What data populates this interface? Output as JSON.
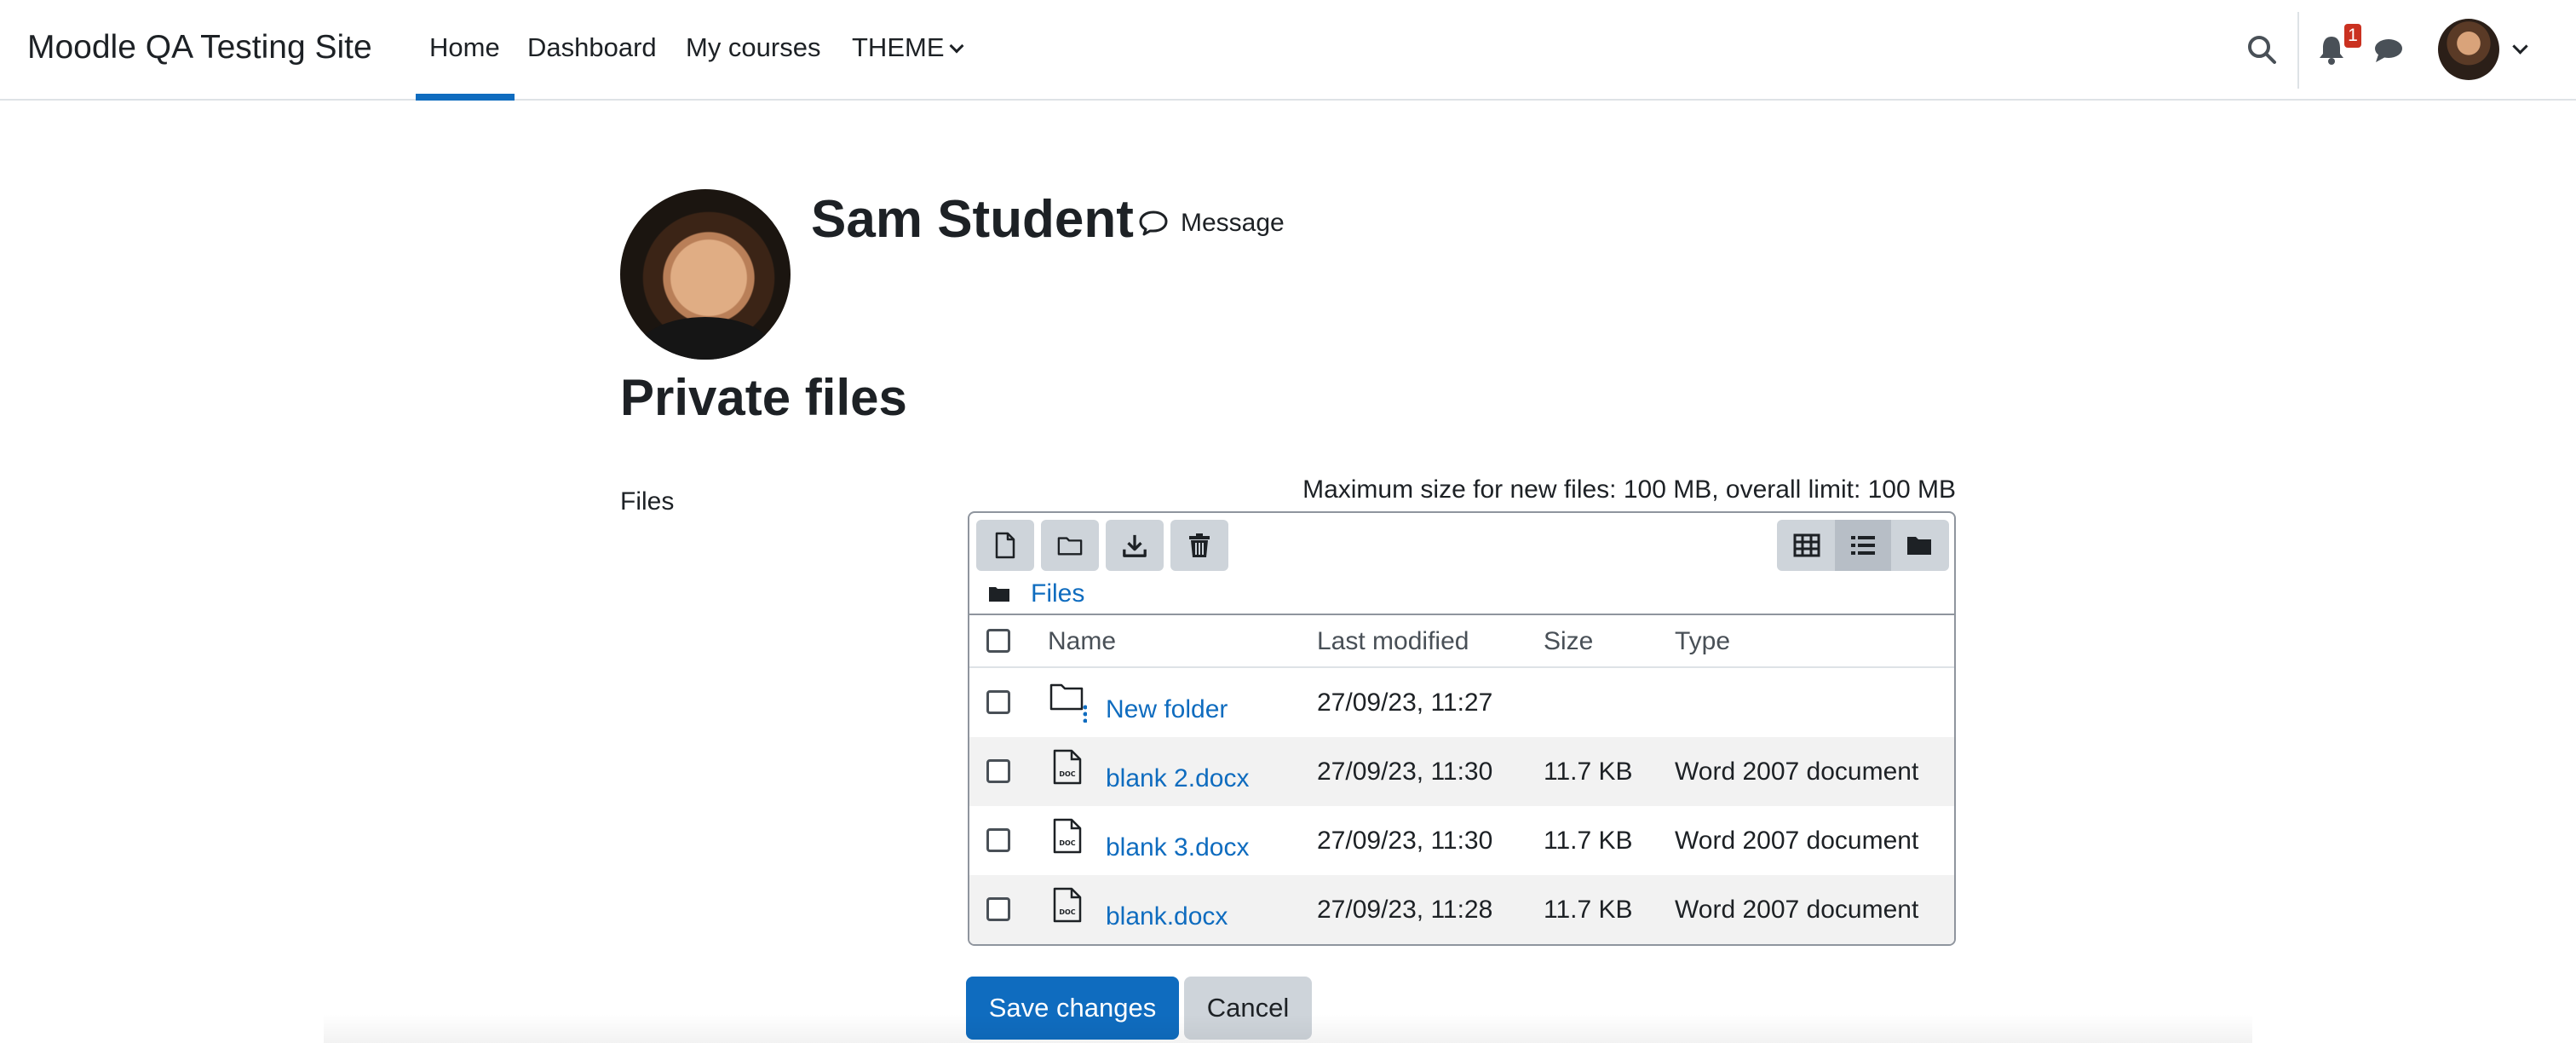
{
  "navbar": {
    "brand": "Moodle QA Testing Site",
    "items": [
      {
        "label": "Home",
        "active": true
      },
      {
        "label": "Dashboard"
      },
      {
        "label": "My courses"
      },
      {
        "label": "THEME"
      }
    ],
    "notification_count": "1",
    "icons": [
      "search-icon",
      "bell-icon",
      "chat-icon",
      "avatar",
      "chevron-down-icon"
    ],
    "accent_color": "#0f6cbf"
  },
  "profile": {
    "name": "Sam Student",
    "message_label": "Message"
  },
  "page": {
    "title": "Private files",
    "files_label": "Files",
    "max_size_text": "Maximum size for new files: 100 MB, overall limit: 100 MB"
  },
  "filemanager": {
    "path": "Files",
    "toolbar_icons": [
      "file-icon",
      "folder-icon",
      "download-icon",
      "trash-icon"
    ],
    "view_icons": [
      "grid-view-icon",
      "list-view-icon",
      "tree-view-icon"
    ],
    "active_view": "list",
    "columns": {
      "name": "Name",
      "modified": "Last modified",
      "size": "Size",
      "type": "Type"
    },
    "rows": [
      {
        "name": "New folder",
        "modified": "27/09/23, 11:27",
        "size": "",
        "type": "",
        "icon": "folder-icon"
      },
      {
        "name": "blank 2.docx",
        "modified": "27/09/23, 11:30",
        "size": "11.7 KB",
        "type": "Word 2007 document",
        "icon": "doc-icon"
      },
      {
        "name": "blank 3.docx",
        "modified": "27/09/23, 11:30",
        "size": "11.7 KB",
        "type": "Word 2007 document",
        "icon": "doc-icon"
      },
      {
        "name": "blank.docx",
        "modified": "27/09/23, 11:28",
        "size": "11.7 KB",
        "type": "Word 2007 document",
        "icon": "doc-icon"
      }
    ]
  },
  "actions": {
    "save": "Save changes",
    "cancel": "Cancel"
  }
}
